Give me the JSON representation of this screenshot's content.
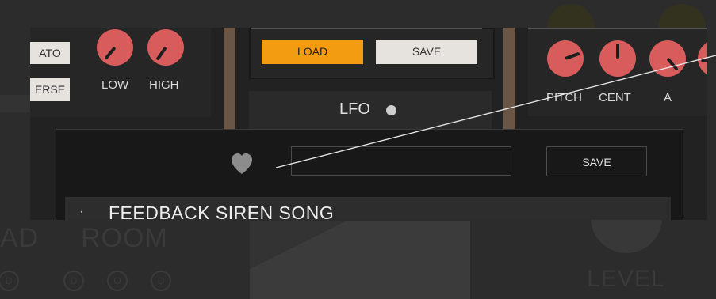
{
  "background": {
    "words": [
      "AD",
      "ROOM",
      "LEVEL"
    ],
    "dots": [
      "D",
      "O",
      "D"
    ]
  },
  "mode_buttons": {
    "legato": "ATO",
    "reverse": "ERSE"
  },
  "filter": {
    "low_label": "LOW",
    "high_label": "HIGH"
  },
  "preset_bar": {
    "load_label": "LOAD",
    "save_label": "SAVE"
  },
  "lfo": {
    "label": "LFO"
  },
  "osc": {
    "pitch_label": "PITCH",
    "cent_label": "CENT",
    "a_label": "A"
  },
  "preset_dialog": {
    "name_placeholder": "",
    "save_label": "SAVE",
    "presets": [
      {
        "bullet": "·",
        "name": "FEEDBACK SIREN SONG"
      }
    ]
  },
  "colors": {
    "accent": "#f39c12",
    "knob": "#d85c5c",
    "separator": "#6b5646"
  }
}
